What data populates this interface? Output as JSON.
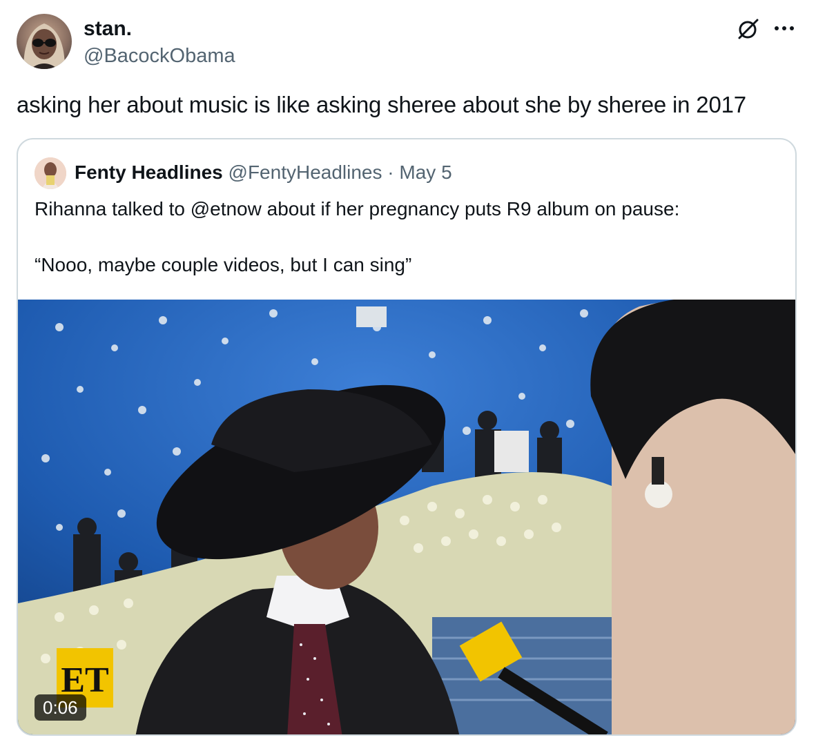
{
  "author": {
    "display_name": "stan.",
    "handle": "@BacockObama",
    "avatar_icon": "profile-photo"
  },
  "tweet": {
    "text": "asking her about music is like asking sheree about she by sheree in 2017"
  },
  "actions": {
    "grok_icon": "grok-icon",
    "more_icon": "more-icon"
  },
  "quoted_tweet": {
    "display_name": "Fenty Headlines",
    "handle": "@FentyHeadlines",
    "separator": "·",
    "date": "May 5",
    "text_line1": "Rihanna talked to @etnow about if her pregnancy puts R9 album on pause:",
    "text_line2": "“Nooo, maybe couple videos, but I can sing”",
    "media": {
      "type": "video",
      "duration": "0:06",
      "logo_text": "ET"
    }
  },
  "colors": {
    "text_primary": "#0f1419",
    "text_secondary": "#536471",
    "border": "#cfd9de",
    "et_yellow": "#f2c400"
  }
}
